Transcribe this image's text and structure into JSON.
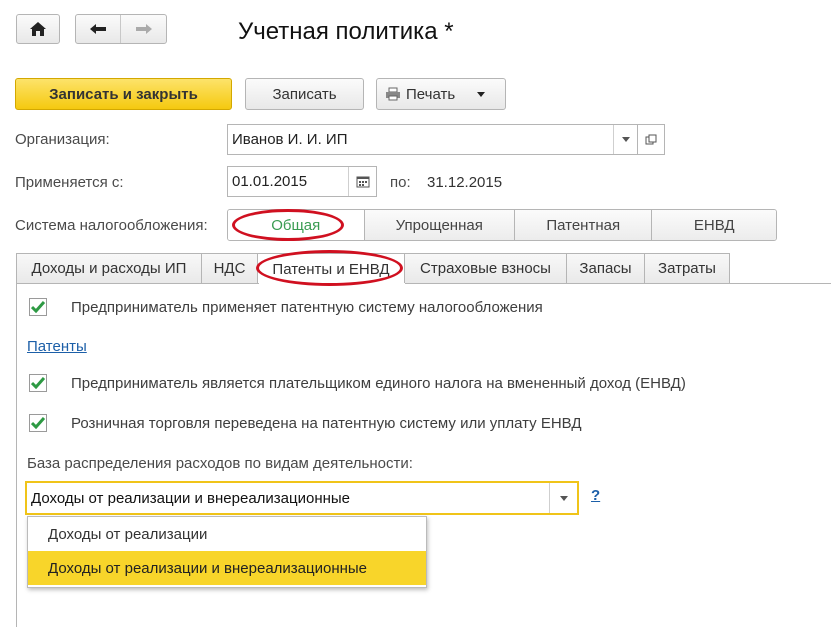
{
  "window": {
    "title": "Учетная политика *"
  },
  "nav": {
    "home_icon": "home-icon",
    "back_icon": "arrow-left-icon",
    "forward_icon": "arrow-right-icon"
  },
  "toolbar": {
    "save_close": "Записать и закрыть",
    "save": "Записать",
    "print": "Печать"
  },
  "form": {
    "org_label": "Организация:",
    "org_value": "Иванов И. И. ИП",
    "applies_label": "Применяется с:",
    "applies_from": "01.01.2015",
    "to_label": "по:",
    "applies_to": "31.12.2015",
    "tax_label": "Система налогообложения:",
    "tax_options": [
      "Общая",
      "Упрощенная",
      "Патентная",
      "ЕНВД"
    ]
  },
  "tabs": [
    "Доходы и расходы ИП",
    "НДС",
    "Патенты и ЕНВД",
    "Страховые взносы",
    "Запасы",
    "Затраты"
  ],
  "content": {
    "check1": "Предприниматель применяет патентную систему налогообложения",
    "patents_link": "Патенты",
    "check2": "Предприниматель является плательщиком единого налога на вмененный доход (ЕНВД)",
    "check3": "Розничная торговля переведена на патентную систему или уплату ЕНВД",
    "base_label": "База распределения расходов по видам деятельности:",
    "base_value": "Доходы от реализации и внереализационные",
    "help": "?",
    "dropdown": [
      "Доходы от реализации",
      "Доходы от реализации и внереализационные"
    ]
  },
  "colors": {
    "accent_yellow": "#f5c90f",
    "highlight": "#f8d52a",
    "annotation": "#d01020",
    "active_tax": "#3a9c52",
    "link": "#1c5fa8"
  }
}
